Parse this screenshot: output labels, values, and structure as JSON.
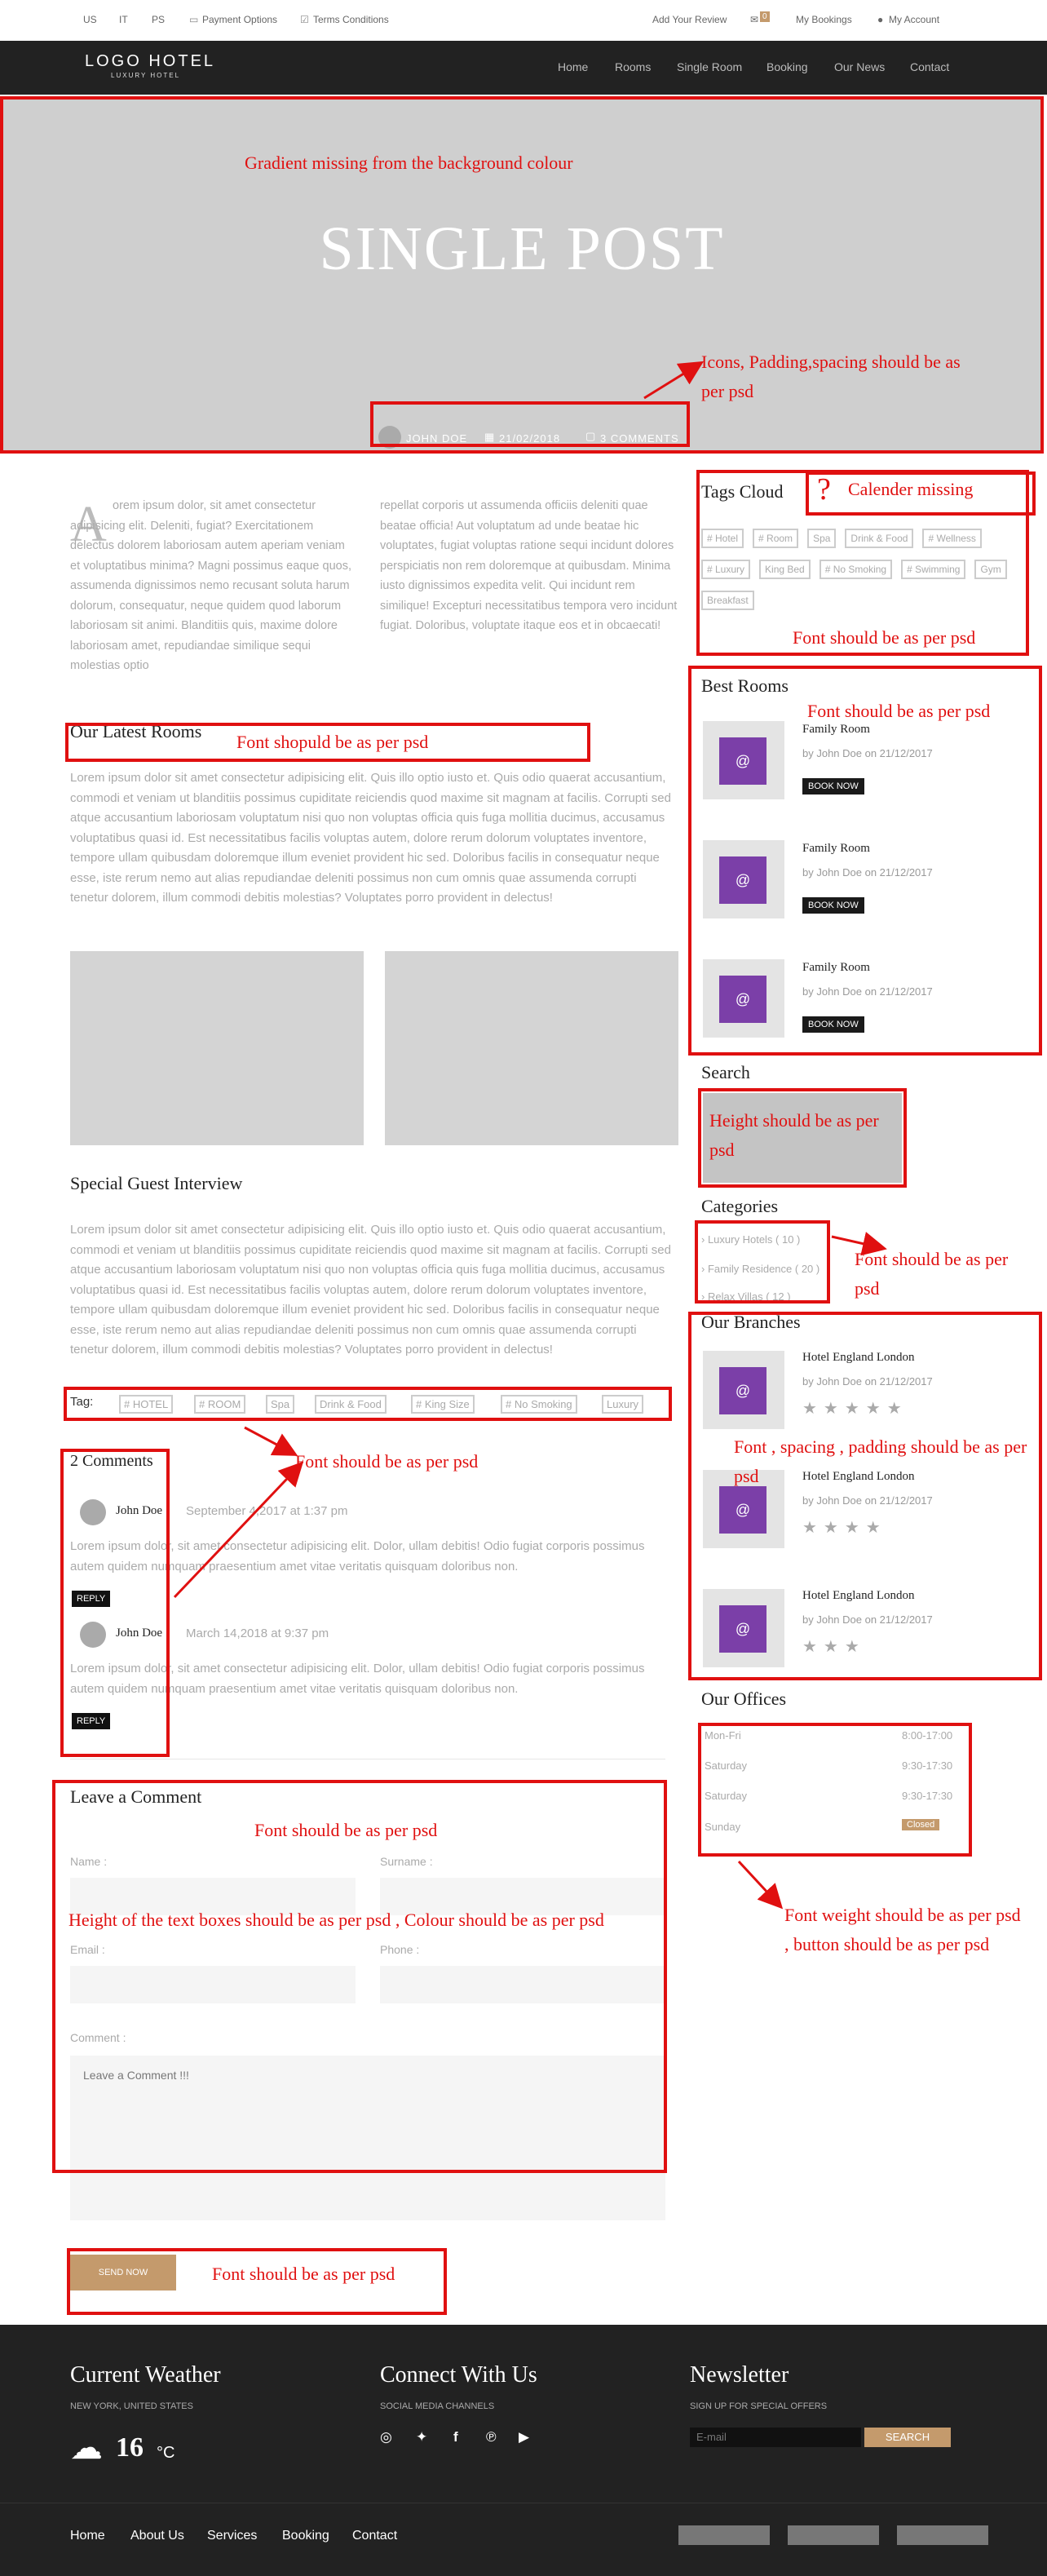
{
  "topbar": {
    "lang_us": "US",
    "lang_it": "IT",
    "lang_ps": "PS",
    "payment": "Payment Options",
    "terms": "Terms Conditions",
    "review": "Add Your Review",
    "cart_count": "0",
    "bookings": "My Bookings",
    "account": "My Account"
  },
  "brand": {
    "logo": "LOGO HOTEL",
    "sub": "LUXURY HOTEL"
  },
  "nav": [
    "Home",
    "Rooms",
    "Single Room",
    "Booking",
    "Our News",
    "Contact"
  ],
  "hero": {
    "title": "SINGLE POST",
    "author": "JOHN DOE",
    "date": "21/02/2018",
    "comments": "3 COMMENTS"
  },
  "article": {
    "drop": "A",
    "col1": "orem ipsum dolor, sit amet consectetur adipisicing elit. Deleniti, fugiat? Exercitationem delectus dolorem laboriosam autem aperiam veniam et voluptatibus minima? Magni possimus eaque quos, assumenda dignissimos nemo recusant soluta harum dolorum, consequatur, neque quidem quod laborum laboriosam sit animi. Blanditiis quis, maxime dolore laboriosam amet, repudiandae similique sequi molestias optio",
    "col2": "repellat corporis ut assumenda officiis deleniti quae beatae officia! Aut voluptatum ad unde beatae hic voluptates, fugiat voluptas ratione sequi incidunt dolores perspiciatis non rem doloremque at quibusdam. Minima iusto dignissimos expedita velit. Qui incidunt rem similique! Excepturi necessitatibus tempora vero incidunt fugiat. Doloribus, voluptate itaque eos et in obcaecati!",
    "latest_title": "Our Latest Rooms",
    "lorem": "Lorem ipsum dolor sit amet consectetur adipisicing elit. Quis illo optio iusto et. Quis odio quaerat accusantium, commodi et veniam ut blanditiis possimus cupiditate reiciendis quod maxime sit magnam at facilis. Corrupti sed atque accusantium laboriosam voluptatum nisi quo non voluptas officia quis fuga mollitia ducimus, accusamus voluptatibus quasi id. Est necessitatibus facilis voluptas autem, dolore rerum dolorum voluptates inventore, tempore ullam quibusdam doloremque illum eveniet provident hic sed. Doloribus facilis in consequatur neque esse, iste rerum nemo aut alias repudiandae deleniti possimus non cum omnis quae assumenda corrupti tenetur dolorem, illum commodi debitis molestias? Voluptates porro provident in delectus!",
    "interview_title": "Special Guest Interview",
    "tag_label": "Tag:",
    "tags": [
      "# HOTEL",
      "# ROOM",
      "Spa",
      "Drink & Food",
      "# King Size",
      "# No Smoking",
      "Luxury"
    ]
  },
  "comments": {
    "title": "2 Comments",
    "items": [
      {
        "name": "John Doe",
        "date": "September 4,2017 at 1:37 pm",
        "text": "Lorem ipsum dolor, sit amet consectetur adipisicing elit. Dolor, ullam debitis! Odio fugiat corporis possimus autem quidem numquam praesentium amet vitae veritatis quisquam doloribus non.",
        "reply": "REPLY"
      },
      {
        "name": "John Doe",
        "date": "March 14,2018 at 9:37 pm",
        "text": "Lorem ipsum dolor, sit amet consectetur adipisicing elit. Dolor, ullam debitis! Odio fugiat corporis possimus autem quidem numquam praesentium amet vitae veritatis quisquam doloribus non.",
        "reply": "REPLY"
      }
    ]
  },
  "form": {
    "title": "Leave a Comment",
    "name": "Name :",
    "surname": "Surname :",
    "email": "Email :",
    "phone": "Phone :",
    "comment": "Comment :",
    "comment_ph": "Leave a Comment !!!",
    "send": "SEND NOW"
  },
  "sidebar": {
    "tags_title": "Tags Cloud",
    "tags": [
      "# Hotel",
      "# Room",
      "Spa",
      "Drink & Food",
      "# Wellness",
      "# Luxury",
      "King Bed",
      "# No Smoking",
      "# Swimming",
      "Gym",
      "Breakfast"
    ],
    "best_title": "Best Rooms",
    "rooms": [
      {
        "name": "Family Room",
        "by": "by John Doe on 21/12/2017",
        "btn": "BOOK NOW"
      },
      {
        "name": "Family Room",
        "by": "by John Doe on 21/12/2017",
        "btn": "BOOK NOW"
      },
      {
        "name": "Family Room",
        "by": "by John Doe on 21/12/2017",
        "btn": "BOOK NOW"
      }
    ],
    "search_title": "Search",
    "cat_title": "Categories",
    "cats": [
      "Luxury Hotels ( 10 )",
      "Family Residence ( 20 )",
      "Relax Villas ( 12 )"
    ],
    "branches_title": "Our Branches",
    "branches": [
      {
        "name": "Hotel England London",
        "by": "by John Doe on 21/12/2017",
        "stars": 5
      },
      {
        "name": "Hotel England London",
        "by": "by John Doe on 21/12/2017",
        "stars": 4
      },
      {
        "name": "Hotel England London",
        "by": "by John Doe on 21/12/2017",
        "stars": 3
      }
    ],
    "offices_title": "Our Offices",
    "offices": [
      {
        "day": "Mon-Fri",
        "time": "8:00-17:00"
      },
      {
        "day": "Saturday",
        "time": "9:30-17:30"
      },
      {
        "day": "Saturday",
        "time": "9:30-17:30"
      },
      {
        "day": "Sunday",
        "time": "Closed"
      }
    ]
  },
  "footer": {
    "weather_title": "Current Weather",
    "weather_sub": "NEW YORK, UNITED STATES",
    "temp": "16",
    "unit": "°C",
    "connect_title": "Connect With Us",
    "connect_sub": "SOCIAL MEDIA CHANNELS",
    "news_title": "Newsletter",
    "news_sub": "SIGN UP FOR SPECIAL OFFERS",
    "email_ph": "E-mail",
    "search_btn": "SEARCH",
    "links": [
      "Home",
      "About Us",
      "Services",
      "Booking",
      "Contact"
    ]
  },
  "notes": {
    "gradient": "Gradient missing from the background colour",
    "icons": "Icons, Padding,spacing should be as per psd",
    "calendar": "Calender missing",
    "font_tags": "Font should be as per psd",
    "font_best": "Font should be as per psd",
    "font_latest": "Font shopuld be as per psd",
    "search_h": "Height should be as per psd",
    "font_cats": "Font should be as per psd",
    "font_branch": "Font , spacing , padding should be as per psd",
    "font_comments": "Font should be as per psd",
    "font_form": "Font should be as per psd",
    "textbox": "Height of the text boxes should be as per psd , Colour should be as per psd",
    "font_weight": "Font weight should be as per psd , button should be as per psd",
    "font_send": "Font should be as per psd"
  },
  "colors": {
    "accent": "#c49a6c",
    "annotation": "#e01010",
    "purple": "#7b3fa8"
  }
}
